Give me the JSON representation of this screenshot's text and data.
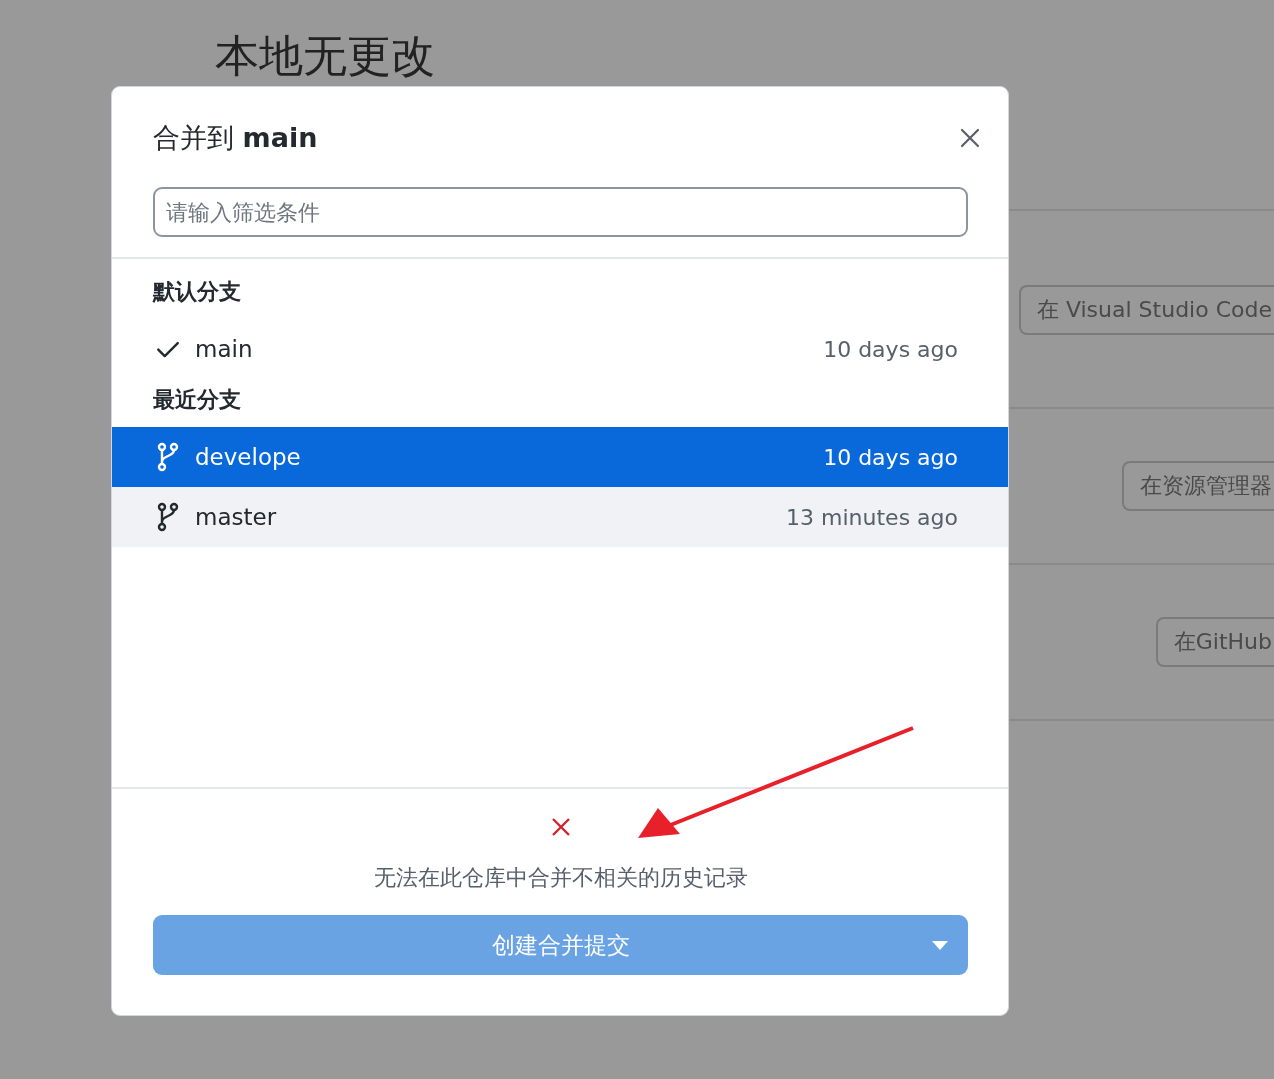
{
  "background": {
    "heading": "本地无更改",
    "actions": [
      {
        "label": "在 Visual Studio Code"
      },
      {
        "label": "在资源管理器"
      },
      {
        "label": "在GitHub"
      }
    ]
  },
  "dialog": {
    "title_prefix": "合并到",
    "title_branch": "main",
    "filter": {
      "placeholder": "请输入筛选条件"
    },
    "sections": [
      {
        "heading": "默认分支",
        "branches": [
          {
            "name": "main",
            "time": "10 days ago",
            "kind": "current",
            "selected": false,
            "hovered": false
          }
        ]
      },
      {
        "heading": "最近分支",
        "branches": [
          {
            "name": "develope",
            "time": "10 days ago",
            "kind": "branch",
            "selected": true,
            "hovered": false
          },
          {
            "name": "master",
            "time": "13 minutes ago",
            "kind": "branch",
            "selected": false,
            "hovered": true
          }
        ]
      }
    ],
    "error": {
      "message": "无法在此仓库中合并不相关的历史记录"
    },
    "submit": {
      "label": "创建合并提交",
      "disabled": true
    }
  }
}
